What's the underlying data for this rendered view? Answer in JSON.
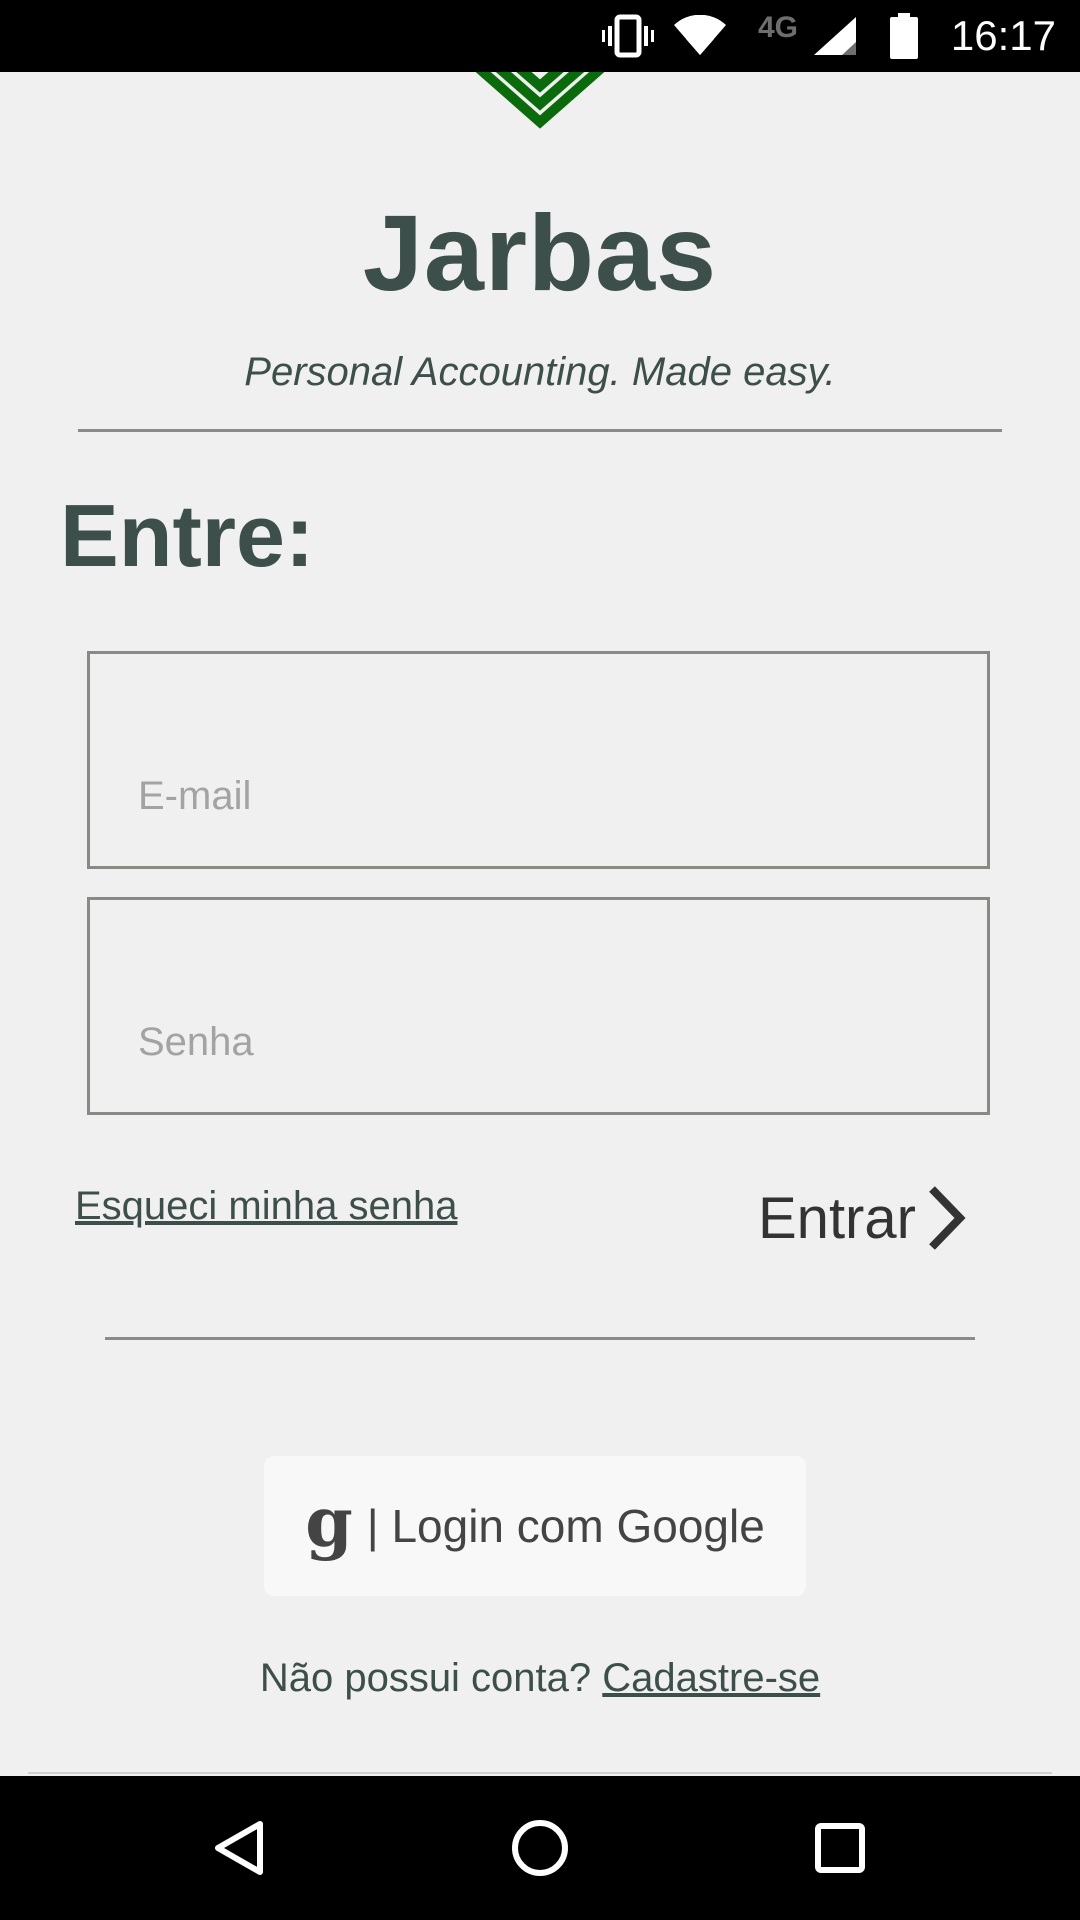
{
  "status_bar": {
    "time": "16:17",
    "network": "4G",
    "icons": [
      "vibrate-icon",
      "wifi-icon",
      "signal-icon",
      "battery-icon"
    ]
  },
  "app": {
    "title": "Jarbas",
    "tagline": "Personal Accounting. Made easy."
  },
  "login": {
    "heading": "Entre:",
    "email_placeholder": "E-mail",
    "password_placeholder": "Senha",
    "forgot_label": "Esqueci minha senha",
    "enter_label": "Entrar",
    "google_icon": "g",
    "google_label": "| Login com Google",
    "signup_prompt": "Não possui conta?",
    "signup_link": "Cadastre-se"
  },
  "nav_bar": {
    "icons": [
      "back-icon",
      "home-icon",
      "recents-icon"
    ]
  },
  "colors": {
    "brand_green": "#0a6b0a",
    "text_dark": "#3d4f4a",
    "background": "#f0f0f0"
  }
}
